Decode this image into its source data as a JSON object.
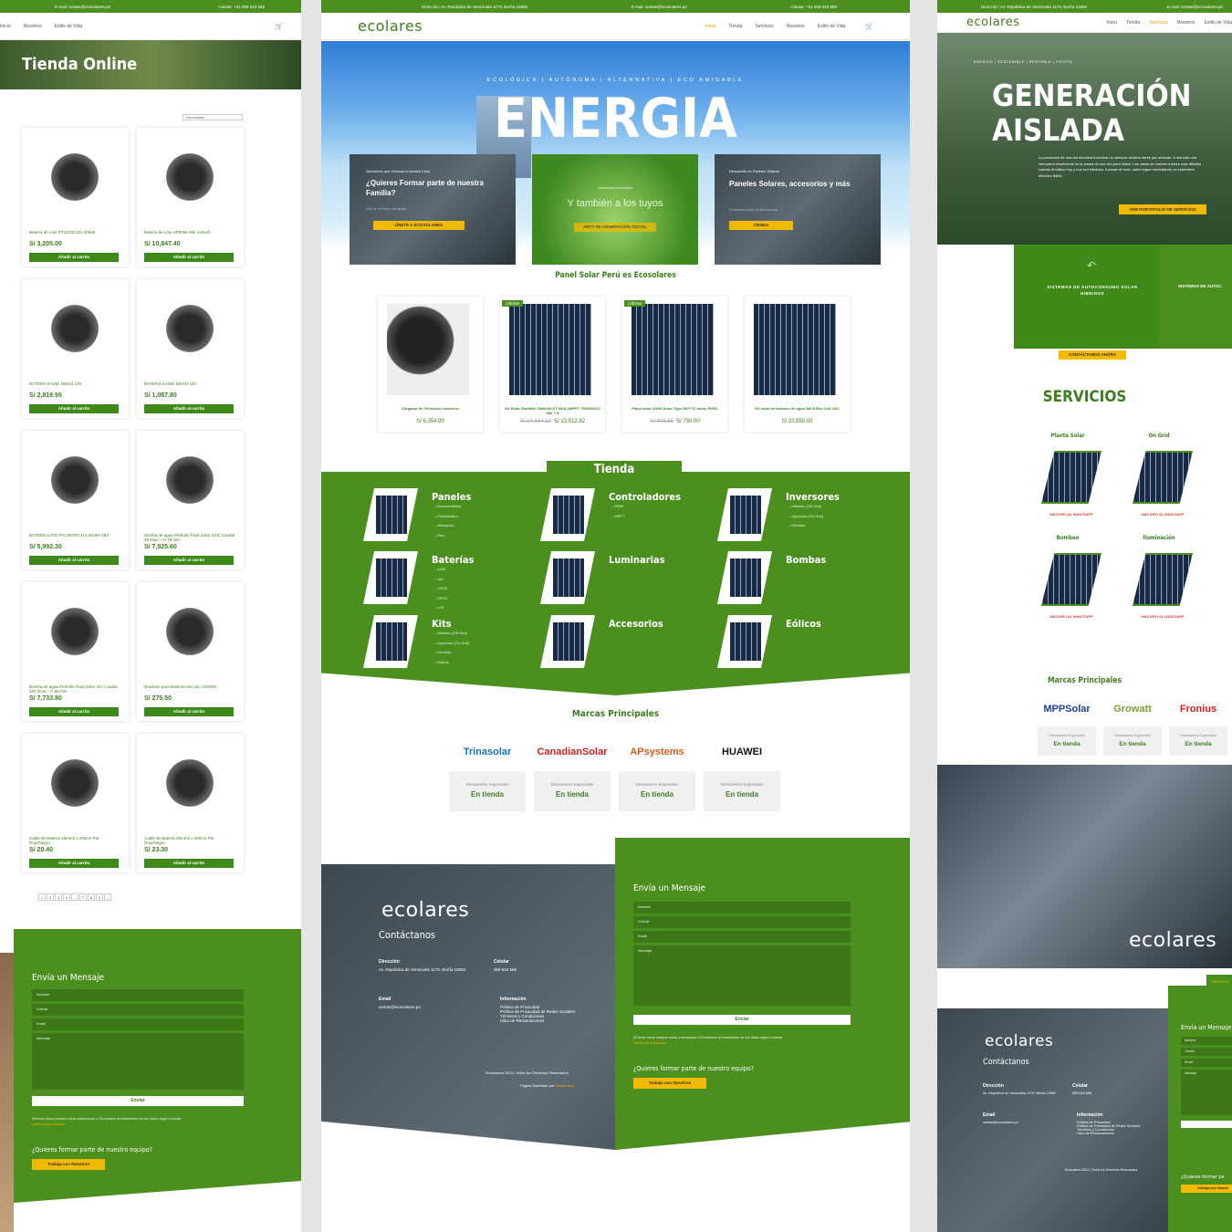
{
  "left": {
    "topbar": {
      "email": "E-mail: ventas@ecosolares.pe",
      "phone": "Celular: +51 959 643 565"
    },
    "nav": [
      "Inicio",
      "Nosotros",
      "Estilo de Vida"
    ],
    "banner": "Tienda Online",
    "sort_label": "Novedades",
    "products": [
      {
        "name": "Batería de Litio RT12100 12v 100ah",
        "price": "S/  3,205.00"
      },
      {
        "name": "Batería de Litio UP5000 48v 4.8Kwh",
        "price": "S/  10,847.40"
      },
      {
        "name": "BATERIA KAISE 150AH 12V",
        "price": "S/  2,819.90"
      },
      {
        "name": "BATERIA KAISE 150AH 12V",
        "price": "S/  1,087.80"
      },
      {
        "name": "BATERIA LITIO PYLONTECH 2.4KWH 48V",
        "price": "S/  5,992.30"
      },
      {
        "name": "Bomba de agua Pedrollo Fluid Solar 1/10; Caudal 38 l/min – H 79 mts",
        "price": "S/  7,925.60"
      },
      {
        "name": "Bomba de agua Pedrollo Fluid Solar 4/4; Caudal 102 l/min – H 58 mts",
        "price": "S/  7,733.80"
      },
      {
        "name": "Brackets para Baterías de Litio US3000",
        "price": "S/  275.50"
      },
      {
        "name": "Cable de Batería 16mm2 x 200cm Par Rojo/Negro",
        "price": "S/  20.40"
      },
      {
        "name": "Cable de Batería 25mm2 x 200cm Par Rojo/Negro",
        "price": "S/  23.30"
      }
    ],
    "add_to_cart": "Añadir al carrito",
    "pagination": [
      "1",
      "2",
      "3",
      "4",
      "…",
      "7",
      "8",
      "9",
      "→"
    ],
    "form": {
      "title": "Envía un Mensaje",
      "fields": [
        "Nombre",
        "Celular",
        "Email",
        "Mensaje"
      ],
      "submit": "Enviar",
      "consent": "Al llenar estos campos estás autorizando a Ecosolares al tratamiento de tus datos según nuestra",
      "consent_link": "política de privacidad",
      "team_q": "¿Quieres formar parte de nuestro equipo?",
      "team_btn": "Trabaja con Nosotros"
    }
  },
  "middle": {
    "topbar": {
      "address": "Dirección: Av. República de Venezuela 1179, Breña 15082",
      "email": "E-mail: ventas@ecosolares.pe",
      "phone": "Celular: +51 959 643 565"
    },
    "logo": "ecolares",
    "nav": [
      "Inicio",
      "Tienda",
      "Servicios",
      "Nosotros",
      "Estilo de Vida"
    ],
    "hero": {
      "tagline": "ECOLÓGICA | AUTÓNOMA | ALTERNATIVA | ECO AMIGABLE",
      "title": "ENERGIA"
    },
    "promo": [
      {
        "kicker": "Queremos que Crezcas a nuestro Lado",
        "title": "¿Quieres Formar parte de nuestra Familia?",
        "sub": "Clic en el botón de abajo",
        "btn": "ÚNETE A ECOSOLARES"
      },
      {
        "kicker": "Ayudamos al planeta",
        "title": "Y también a los tuyos",
        "sub": "",
        "btn": "ARTY DE GENERACIÓN SOCIAL"
      },
      {
        "kicker": "Descuento en Paneles Solares",
        "title": "Paneles Solares, accesorios y más",
        "sub": "Encuentra todo lo que buscas",
        "btn": "TIENDA"
      }
    ],
    "featured_title": "Panel Solar Perú es Ecosolares",
    "featured": [
      {
        "name": "Cargador de Vehículos eléctricos",
        "old": "",
        "price": "S/  6,354.99",
        "badge": ""
      },
      {
        "name": "Kit Solar GoodWe GW6000-DT 6KW 2MPPT TRIFÁSICO 380 + N",
        "old": "S/  14,664.10",
        "price": "S/  13,512.82",
        "badge": "¡Oferta!"
      },
      {
        "name": "Placa solar 410W Jinko Tiger MC+TO mono PERC",
        "old": "S/  828.55",
        "price": "S/  730.00",
        "badge": "¡Oferta!"
      },
      {
        "name": "Kit solar de bombeo de agua 380 5.5kw 1AA 3AC",
        "old": "",
        "price": "S/  22,550.00",
        "badge": ""
      }
    ],
    "shop_title": "Tienda",
    "categories": [
      {
        "name": "Paneles",
        "subs": [
          "Monocristalino",
          "Policristalino",
          "Monoperc",
          "Perc"
        ]
      },
      {
        "name": "Controladores",
        "subs": [
          "PWM",
          "MPPT"
        ]
      },
      {
        "name": "Inversores",
        "subs": [
          "Aislados (Off Grid)",
          "Inyección (On Grid)",
          "Híbridos"
        ]
      },
      {
        "name": "Baterías",
        "subs": [
          "AGM",
          "Gel",
          "OPZS",
          "OPZV",
          "LFE"
        ]
      },
      {
        "name": "Luminarias",
        "subs": []
      },
      {
        "name": "Bombas",
        "subs": []
      },
      {
        "name": "Kits",
        "subs": [
          "Aislados (Off Grid)",
          "Inyección (On Grid)",
          "Híbridos",
          "Eólicos"
        ]
      },
      {
        "name": "Accesorios",
        "subs": []
      },
      {
        "name": "Eólicos",
        "subs": []
      }
    ],
    "brands_title": "Marcas Principales",
    "brands": [
      "Trinasolar",
      "CanadianSolar",
      "APsystems",
      "HUAWEI"
    ],
    "brand_sub": "Descuentos Especiales",
    "brand_link": "En tienda",
    "footer": {
      "contact_title": "Contáctanos",
      "dir_label": "Dirección",
      "dir": "Av. República de Venezuela 1179, Breña 15082",
      "cel_label": "Celular",
      "cel": "959 643 565",
      "email_label": "Email",
      "email": "ventas@ecosolares.pe",
      "info_label": "Información",
      "info": [
        "Política de Privacidad",
        "Política de Privacidad de Redes Sociales",
        "Términos y Condiciones",
        "Libro de Reclamaciones"
      ],
      "copyright": "Ecosolares 2024 | Todos los Derechos Reservados.",
      "credit": "Página Diseñada por",
      "credit_link": "Edison Azur"
    }
  },
  "right": {
    "hero_kicker": "ENERGÍA | SOSTENIBLE | RENTABLE | PROPIA",
    "hero_title1": "GENERACIÓN",
    "hero_title2": "AISLADA",
    "hero_text": "La presencia de una red eléctrica funcional no siempre debería darse por sentado. A menudo una estructura insuficiente es la causa de una red poco fiable. Las casas se vuelven incluso más difíciles cuando el tráfico hoy y una red eléctrica. A pesar de todo, usted sigue necesitando un suministro eléctrico fiable.",
    "hero_btn": "VER PORTAFOLIO DE SERVICIOS",
    "cards": [
      {
        "title": "SISTEMAS DE AUTOCONSUMO SOLAR HÍBRIDOS",
        "btn": "CONTÁCTANOS AHORA"
      },
      {
        "title": "SISTEMAS DE AUTOC",
        "btn": "VER"
      }
    ],
    "services_title": "SERVICIOS",
    "services": [
      "Planta Solar",
      "On Grid",
      "Bombeo",
      "Iluminación"
    ],
    "services_link": "MÁS INFO AL WHATSAPP",
    "brands_title": "Marcas Principales",
    "brands": [
      "MPPSolar",
      "Growatt",
      "Fronius"
    ],
    "brand_sub": "Descuentos Especiales",
    "brand_link": "En tienda",
    "tag": "SERVICIOS",
    "contact_title": "Contáctanos",
    "form_title": "Envía un Mensaje",
    "team_q": "¿Quieres formar pa",
    "team_btn": "Trabaja con Nosotr"
  }
}
